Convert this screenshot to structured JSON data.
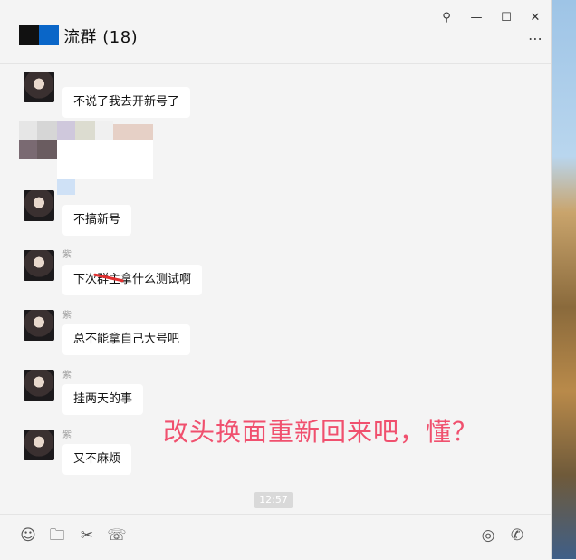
{
  "window": {
    "title": "流群 (18)",
    "controls": {
      "pin": "⚲",
      "minimize": "—",
      "maximize": "☐",
      "close": "✕"
    },
    "more": "⋯"
  },
  "messages": [
    {
      "text": "不说了我去开新号了"
    },
    {
      "text": "不搞新号"
    },
    {
      "text": "下次群主拿什么测试啊"
    },
    {
      "text": "总不能拿自己大号吧"
    },
    {
      "text": "挂两天的事"
    },
    {
      "text": "又不麻烦"
    }
  ],
  "overlay_text": "改头换面重新回来吧，懂？",
  "timestamp": "12:57",
  "toolbar": {
    "emoji": "☺",
    "folder": "🗀",
    "scissors": "✂",
    "chat": "☏",
    "record": "◎",
    "call": "✆"
  },
  "colors": {
    "overlay": "#f0506e",
    "redact_blue": "#0a66c8"
  }
}
